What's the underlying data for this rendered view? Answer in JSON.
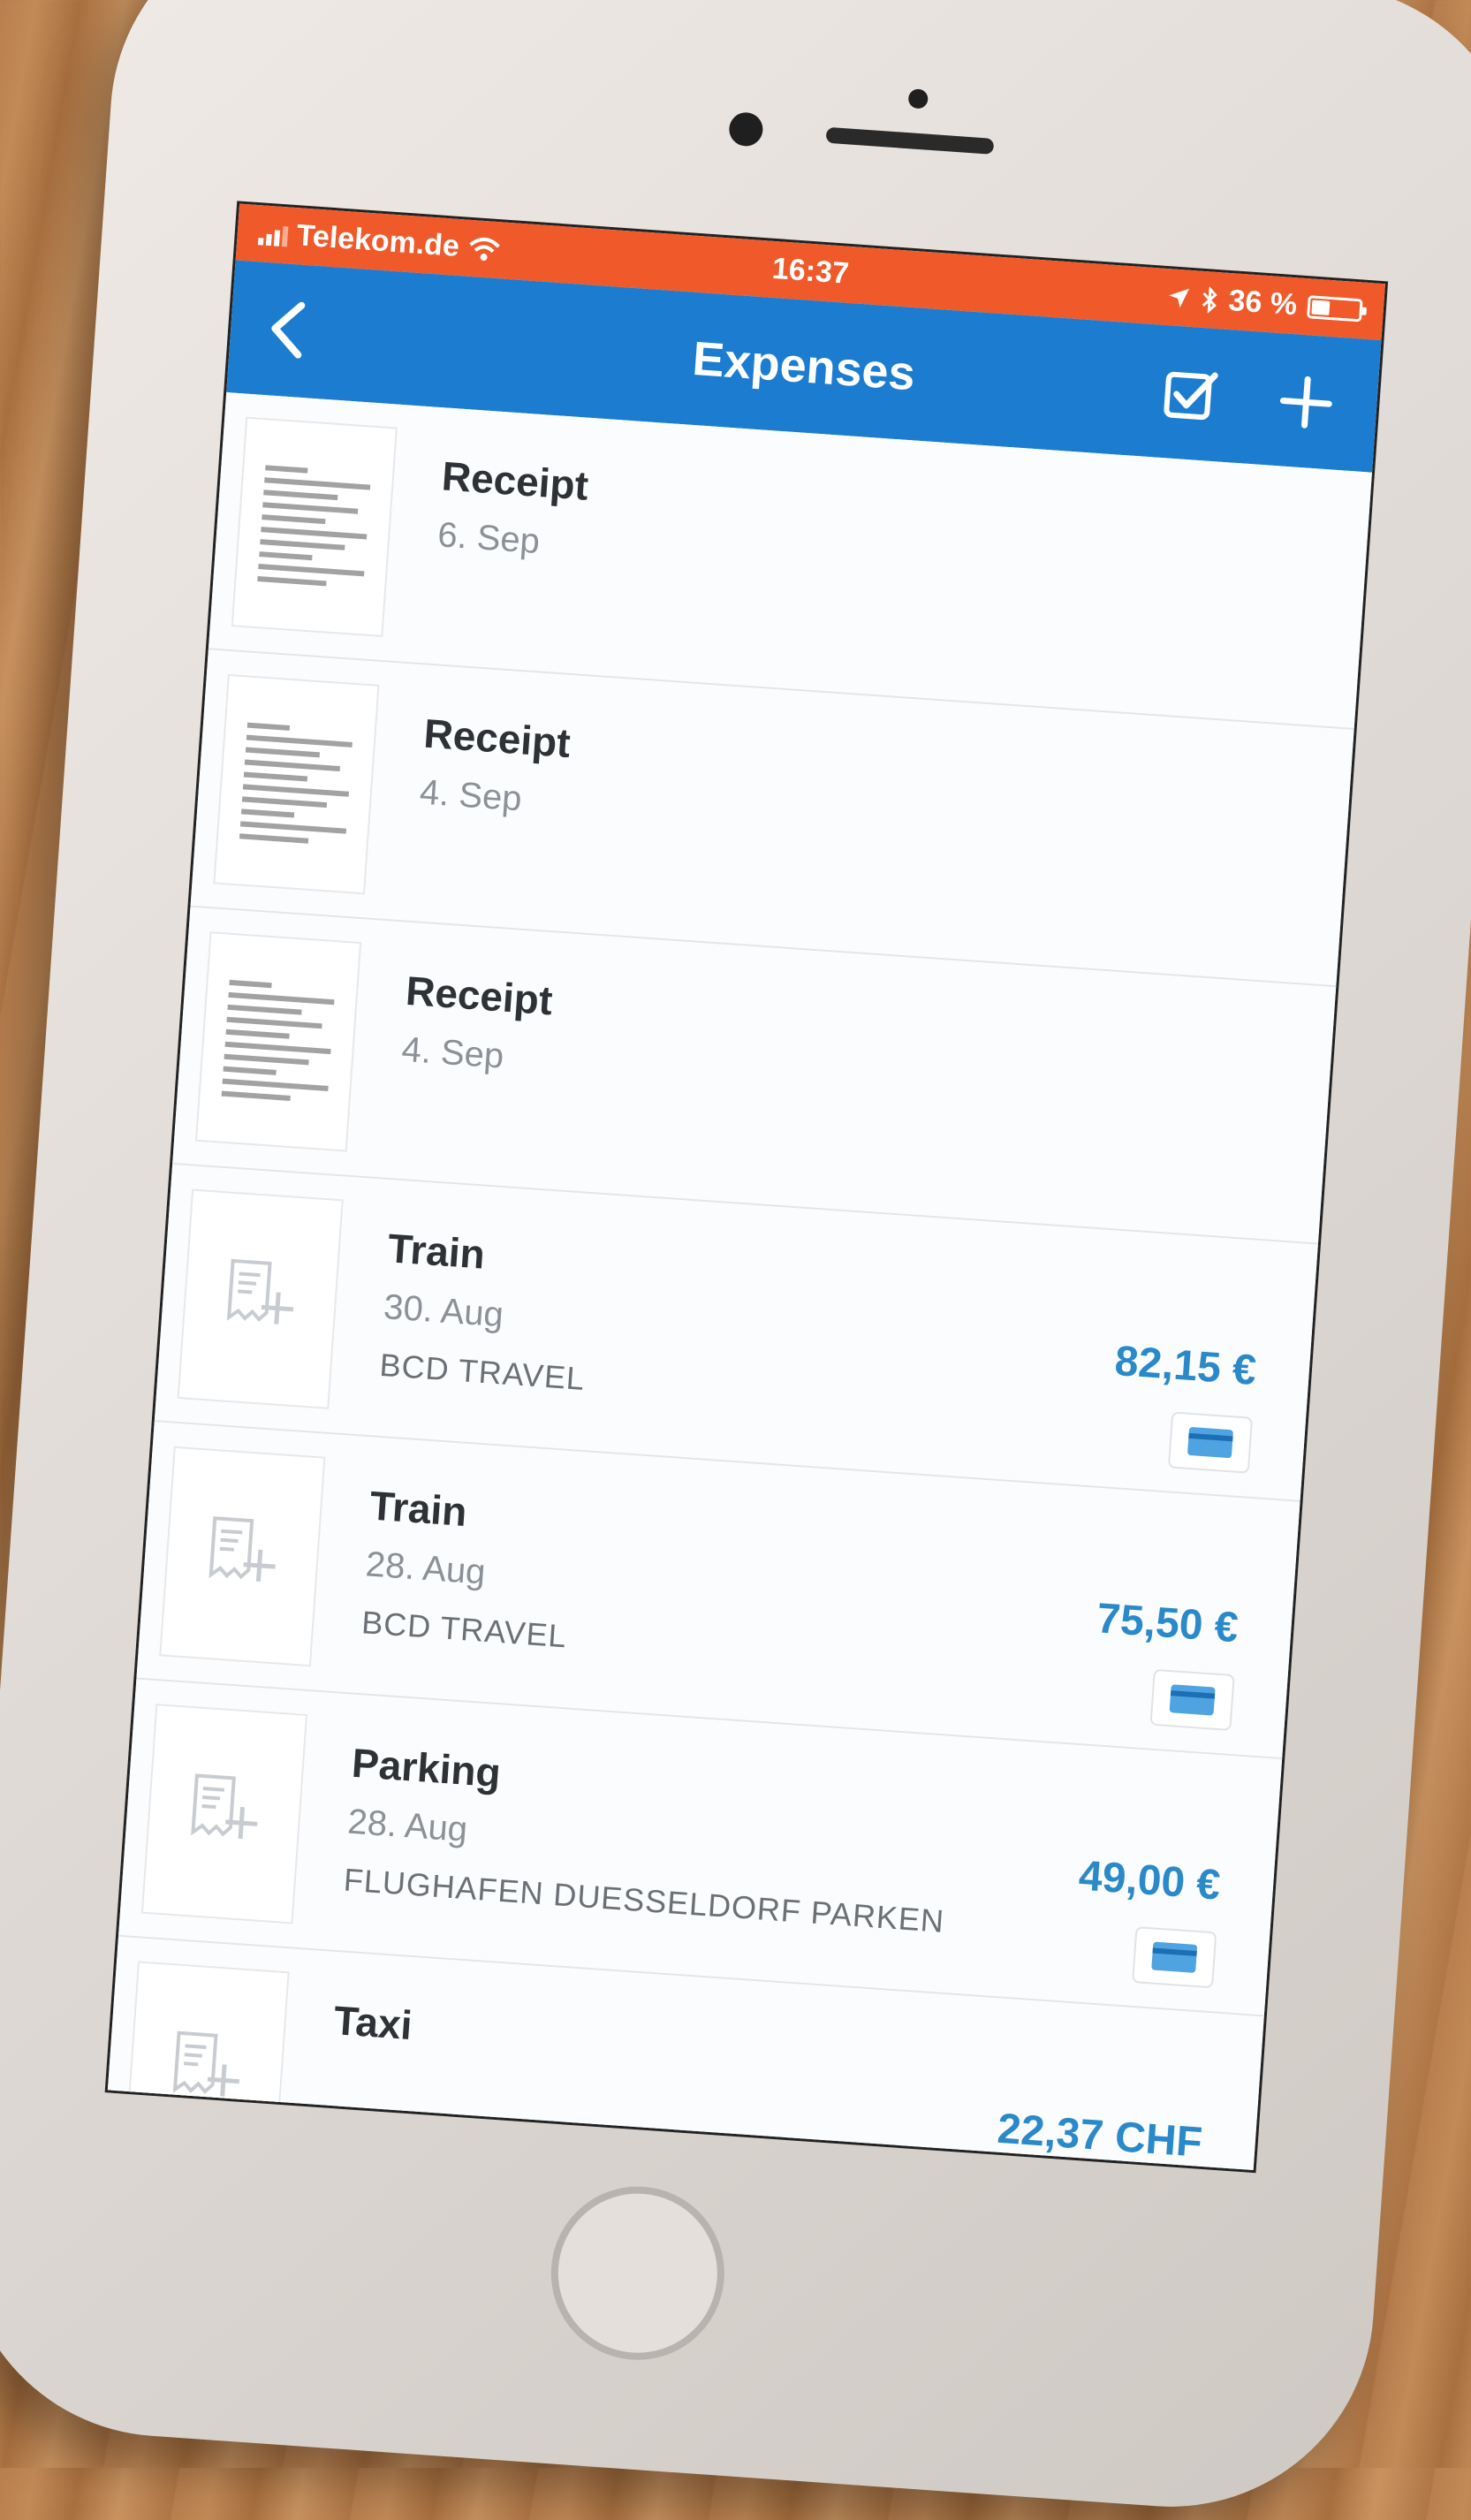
{
  "status_bar": {
    "carrier": "Telekom.de",
    "time": "16:37",
    "battery": "36 %"
  },
  "nav": {
    "title": "Expenses"
  },
  "expenses": [
    {
      "title": "Receipt",
      "date": "6. Sep",
      "vendor": "",
      "amount": "",
      "has_receipt": true
    },
    {
      "title": "Receipt",
      "date": "4. Sep",
      "vendor": "",
      "amount": "",
      "has_receipt": true
    },
    {
      "title": "Receipt",
      "date": "4. Sep",
      "vendor": "",
      "amount": "",
      "has_receipt": true
    },
    {
      "title": "Train",
      "date": "30. Aug",
      "vendor": "BCD TRAVEL",
      "amount": "82,15 €",
      "has_receipt": false
    },
    {
      "title": "Train",
      "date": "28. Aug",
      "vendor": "BCD TRAVEL",
      "amount": "75,50 €",
      "has_receipt": false
    },
    {
      "title": "Parking",
      "date": "28. Aug",
      "vendor": "FLUGHAFEN DUESSELDORF PARKEN",
      "amount": "49,00 €",
      "has_receipt": false
    },
    {
      "title": "Taxi",
      "date": "",
      "vendor": "",
      "amount": "22,37 CHF",
      "has_receipt": false
    }
  ],
  "colors": {
    "status_bar": "#f05a2a",
    "nav_bar": "#1c7dd0",
    "amount": "#2a89c9"
  }
}
